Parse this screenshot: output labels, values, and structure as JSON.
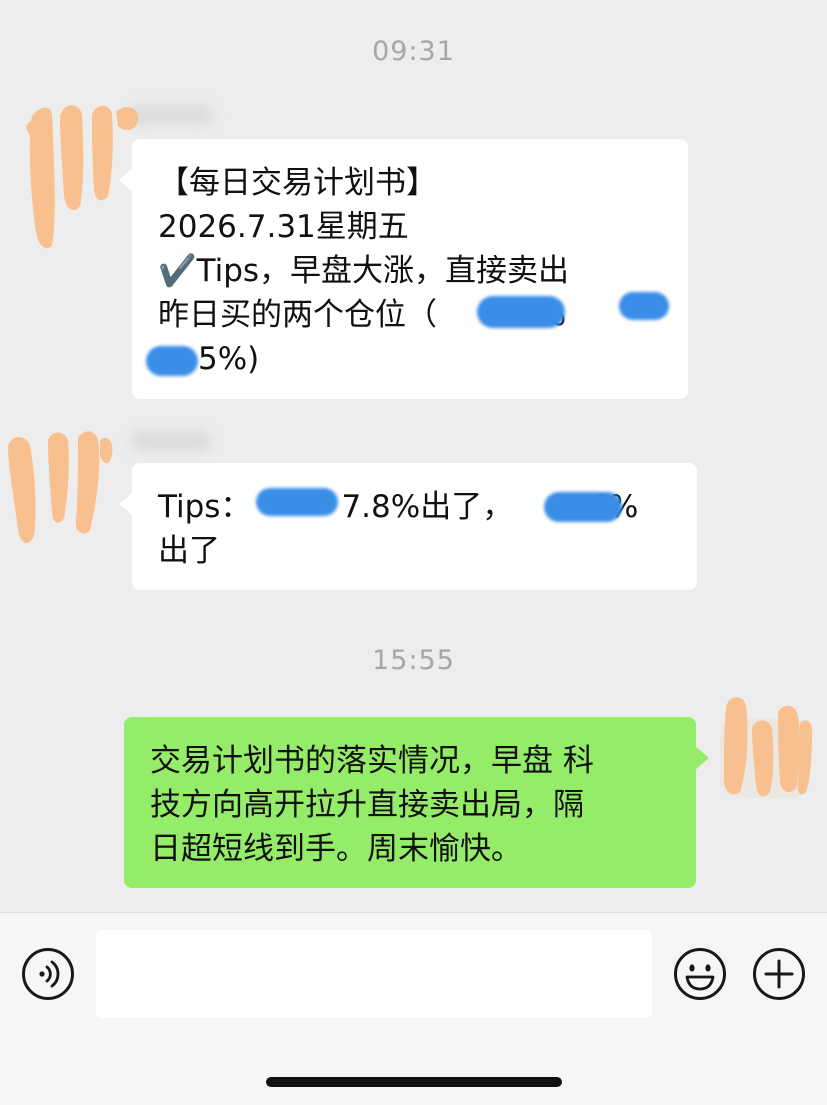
{
  "chat": {
    "time1": "09:31",
    "time2": "15:55",
    "msg1": {
      "line1": "【每日交易计划书】",
      "line2": "2026.7.31星期五",
      "line3": "✔️Tips，早盘大涨，直接卖出",
      "line4": "昨日买的两个仓位（",
      "line4b": "5%",
      "line5b": "5%)"
    },
    "msg2": {
      "line1a": "Tips：",
      "line1b": "7.8%出了，",
      "line1c": "6%",
      "line2": "出了"
    },
    "msg3": {
      "line1": "交易计划书的落实情况，早盘 科",
      "line2": "技方向高开拉升直接卖出局，隔",
      "line3": "日超短线到手。周末愉快。"
    }
  },
  "input_bar": {
    "voice_icon": "voice-icon",
    "emoji_icon": "emoji-icon",
    "add_icon": "plus-icon"
  },
  "colors": {
    "background": "#ededed",
    "outgoing_bubble": "#95ec69",
    "incoming_bubble": "#ffffff",
    "redaction": "#3a8ee8",
    "avatar_paint": "#f8c08e"
  }
}
